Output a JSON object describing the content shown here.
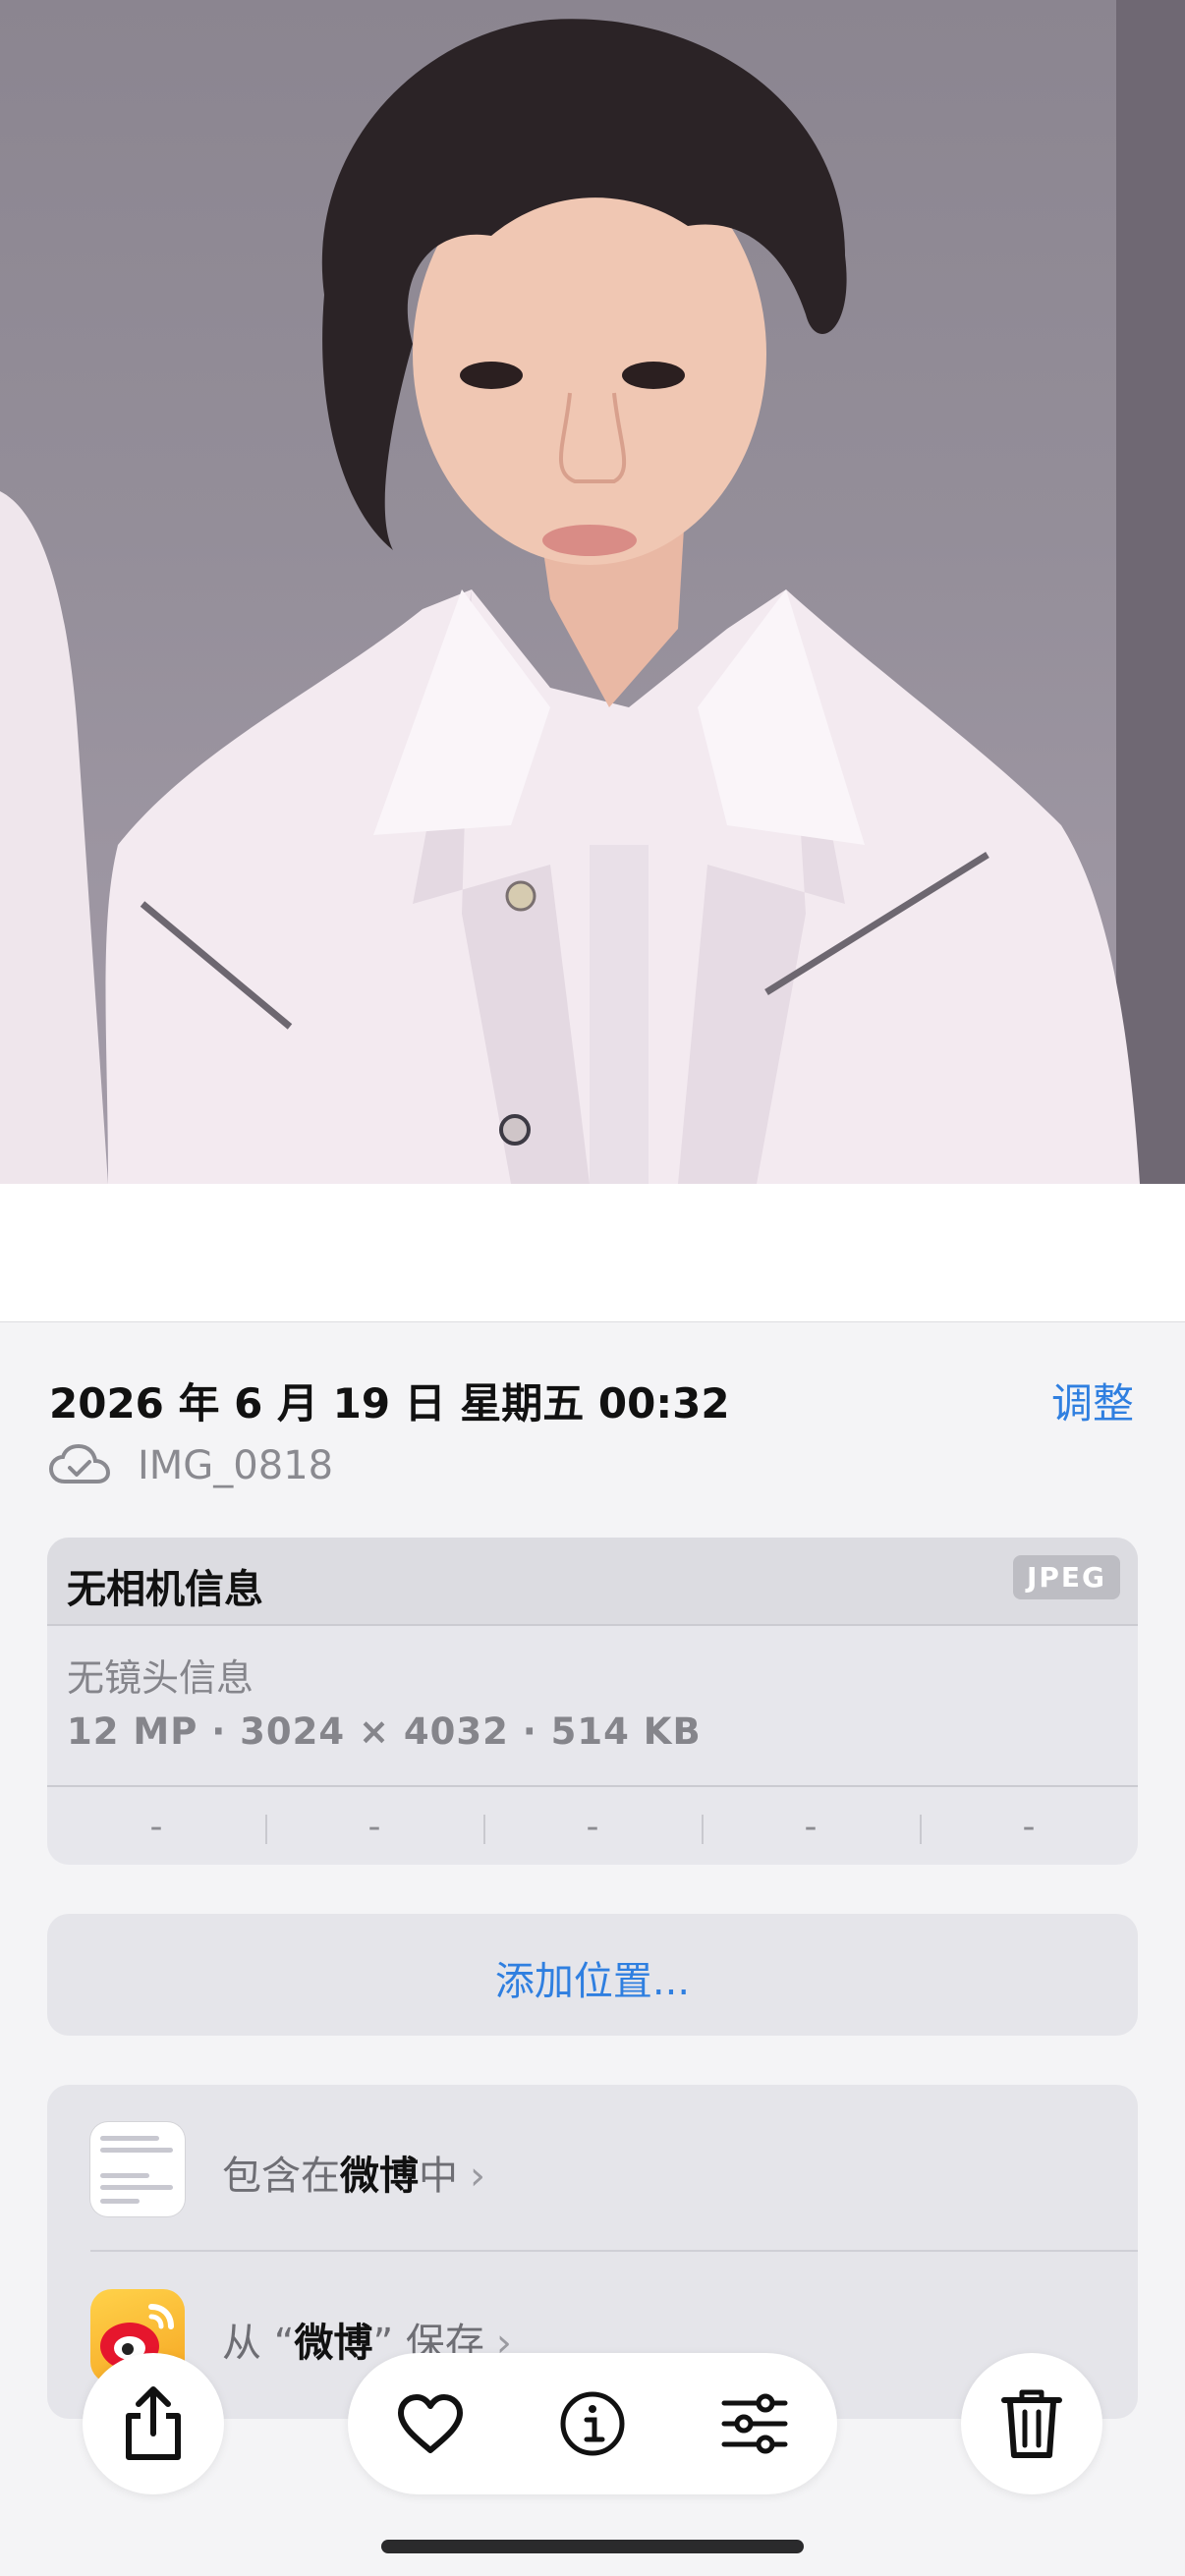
{
  "photo": {
    "subject": "portrait"
  },
  "caption": {
    "text": ""
  },
  "info": {
    "date": "2026 年 6 月 19 日 星期五 00:32",
    "adjust_label": "调整",
    "file_name": "IMG_0818",
    "icon": "cloud-check-icon"
  },
  "camera": {
    "title": "无相机信息",
    "format_badge": "JPEG",
    "lens": "无镜头信息",
    "specs": "12 MP · 3024 × 4032 · 514 KB",
    "exif": [
      "-",
      "-",
      "-",
      "-",
      "-"
    ]
  },
  "location": {
    "add_label": "添加位置..."
  },
  "apps": {
    "included_prefix": "包含在",
    "included_app": "微博",
    "included_suffix": "中",
    "saved_prefix": "从 “",
    "saved_app": "微博",
    "saved_suffix": "” 保存",
    "chevron": "›"
  },
  "toolbar": {
    "icons": [
      "share-icon",
      "heart-icon",
      "info-icon",
      "adjust-icon",
      "trash-icon"
    ]
  },
  "colors": {
    "accent": "#2f7fe0",
    "background": "#f4f4f6"
  }
}
